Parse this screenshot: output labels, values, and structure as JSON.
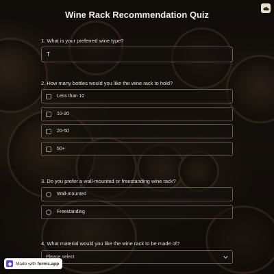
{
  "form": {
    "title": "Wine Rack Recommendation Quiz",
    "q1": {
      "label": "1.  What is your preferred wine type?",
      "value": "T"
    },
    "q2": {
      "label": "2. How many bottles would you like the wine rack to hold?",
      "options": [
        "Less than 10",
        "10-20",
        "20-50",
        "50+"
      ]
    },
    "q3": {
      "label": "3. Do you prefer a wall-mounted or freestanding wine rack?",
      "options": [
        "Wall-mounted",
        "Freestanding"
      ]
    },
    "q4": {
      "label": "4. What material would you like the wine rack to be made of?",
      "placeholder": "Please select"
    }
  },
  "badge": {
    "prefix": "Made with",
    "brand": "forms.app"
  },
  "icons": {
    "corner": "cloud-icon",
    "select": "chevron-down-icon",
    "badge_logo": "forms-app-logo-icon"
  },
  "colors": {
    "badge_logo": "#5b4bd6",
    "corner_button": "#e9dfc9"
  }
}
